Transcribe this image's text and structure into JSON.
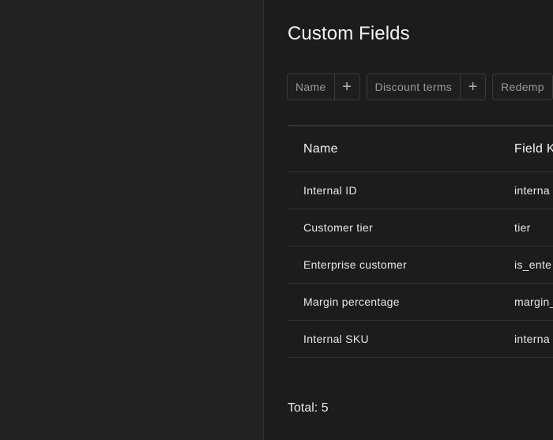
{
  "page": {
    "title": "Custom Fields"
  },
  "filters": [
    {
      "label": "Name",
      "add_icon": "plus-icon"
    },
    {
      "label": "Discount terms",
      "add_icon": "plus-icon"
    },
    {
      "label": "Redemp",
      "add_icon": "plus-icon"
    }
  ],
  "table": {
    "columns": [
      "Name",
      "Field K"
    ],
    "rows": [
      {
        "name": "Internal ID",
        "field_key": "interna"
      },
      {
        "name": "Customer tier",
        "field_key": "tier"
      },
      {
        "name": "Enterprise customer",
        "field_key": "is_ente"
      },
      {
        "name": "Margin percentage",
        "field_key": "margin_"
      },
      {
        "name": "Internal SKU",
        "field_key": "interna"
      }
    ]
  },
  "footer": {
    "total": "Total: 5"
  },
  "colors": {
    "background": "#1c1c1c",
    "sidebar": "#222222",
    "border": "#333333",
    "text": "#e6e6e6",
    "muted_text": "#9a9a9a"
  }
}
